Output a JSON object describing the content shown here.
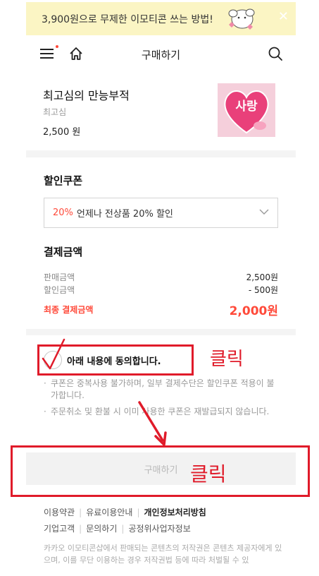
{
  "banner": {
    "text": "3,900원으로 무제한 이모티콘 쓰는 방법!",
    "close": "✕"
  },
  "header": {
    "title": "구매하기"
  },
  "product": {
    "name": "최고심의 만능부적",
    "author": "최고심",
    "price": "2,500 원",
    "thumbnail_text": "사랑"
  },
  "coupon": {
    "title": "할인쿠폰",
    "percent": "20%",
    "label": "언제나 전상품 20% 할인"
  },
  "payment": {
    "title": "결제금액",
    "sale_label": "판매금액",
    "sale_value": "2,500원",
    "discount_label": "할인금액",
    "discount_value": "- 500원",
    "final_label": "최종 결제금액",
    "final_value": "2,000원"
  },
  "agreement": {
    "label": "아래 내용에 동의합니다."
  },
  "annotation": {
    "click1": "클릭",
    "click2": "클릭"
  },
  "notes": [
    "쿠폰은 중복사용 불가하며, 일부 결제수단은 할인쿠폰 적용이 불가합니다.",
    "주문취소 및 환불 시 이미 사용한 쿠폰은 재발급되지 않습니다."
  ],
  "buy_button": {
    "label": "구매하기"
  },
  "footer": {
    "links_row1": [
      "이용약관",
      "유료이용안내",
      "개인정보처리방침"
    ],
    "links_row2": [
      "기업고객",
      "문의하기",
      "공정위사업자정보"
    ],
    "note": "카카오 이모티콘샵에서 판매되는 콘텐츠의 저작권은 콘텐츠 제공자에게 있으며, 이를 무단 이용하는 경우 저작권법 등에 따라 처벌될 수 있"
  },
  "colors": {
    "accent_red": "#ff4a3a",
    "annotation_red": "#e01b2a",
    "banner_bg": "#fbf5c4"
  },
  "icons": [
    "menu-icon",
    "home-icon",
    "search-icon",
    "close-icon",
    "chevron-down-icon",
    "check-icon"
  ]
}
